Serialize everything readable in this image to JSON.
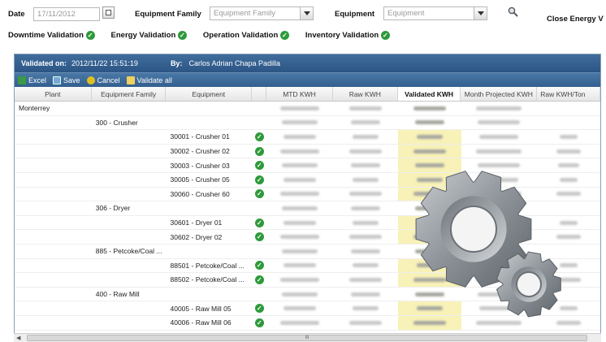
{
  "filters": {
    "date_label": "Date",
    "date_value": "17/11/2012",
    "equipment_family_label": "Equipment Family",
    "equipment_family_value": "Equipment Family",
    "equipment_label": "Equipment",
    "equipment_value": "Equipment",
    "close_label": "Close Energy V"
  },
  "validations": [
    {
      "label": "Downtime Validation"
    },
    {
      "label": "Energy Validation"
    },
    {
      "label": "Operation Validation"
    },
    {
      "label": "Inventory Validation"
    }
  ],
  "grid": {
    "validated_on_label": "Validated on:",
    "validated_on_value": "2012/11/22 15:51:19",
    "by_label": "By:",
    "by_value": "Carlos Adrian Chapa Padilla",
    "toolbar": {
      "excel": "Excel",
      "save": "Save",
      "cancel": "Cancel",
      "validate_all": "Validate all"
    },
    "columns": [
      "Plant",
      "Equipment Family",
      "Equipment",
      "",
      "MTD KWH",
      "Raw KWH",
      "Validated KWH",
      "Month Projected KWH",
      "Raw KWH/Ton"
    ],
    "rows": [
      {
        "plant": "Monterrey",
        "family": "",
        "equipment": "",
        "check": false
      },
      {
        "plant": "",
        "family": "300 - Crusher",
        "equipment": "",
        "check": false
      },
      {
        "plant": "",
        "family": "",
        "equipment": "30001 - Crusher 01",
        "check": true
      },
      {
        "plant": "",
        "family": "",
        "equipment": "30002 - Crusher 02",
        "check": true
      },
      {
        "plant": "",
        "family": "",
        "equipment": "30003 - Crusher 03",
        "check": true
      },
      {
        "plant": "",
        "family": "",
        "equipment": "30005 - Crusher 05",
        "check": true
      },
      {
        "plant": "",
        "family": "",
        "equipment": "30060 - Crusher 60",
        "check": true
      },
      {
        "plant": "",
        "family": "306 - Dryer",
        "equipment": "",
        "check": false
      },
      {
        "plant": "",
        "family": "",
        "equipment": "30601 - Dryer 01",
        "check": true
      },
      {
        "plant": "",
        "family": "",
        "equipment": "30602 - Dryer 02",
        "check": true
      },
      {
        "plant": "",
        "family": "885 - Petcoke/Coal ...",
        "equipment": "",
        "check": false
      },
      {
        "plant": "",
        "family": "",
        "equipment": "88501 - Petcoke/Coal ...",
        "check": true
      },
      {
        "plant": "",
        "family": "",
        "equipment": "88502 - Petcoke/Coal ...",
        "check": true
      },
      {
        "plant": "",
        "family": "400 - Raw Mill",
        "equipment": "",
        "check": false
      },
      {
        "plant": "",
        "family": "",
        "equipment": "40005 - Raw Mill 05",
        "check": true
      },
      {
        "plant": "",
        "family": "",
        "equipment": "40006 - Raw Mill 06",
        "check": true
      }
    ],
    "scroll_label": "III"
  },
  "colors": {
    "header": "#2c5585",
    "check": "#2e9a3a",
    "validated_cell": "#f8f2b8"
  }
}
